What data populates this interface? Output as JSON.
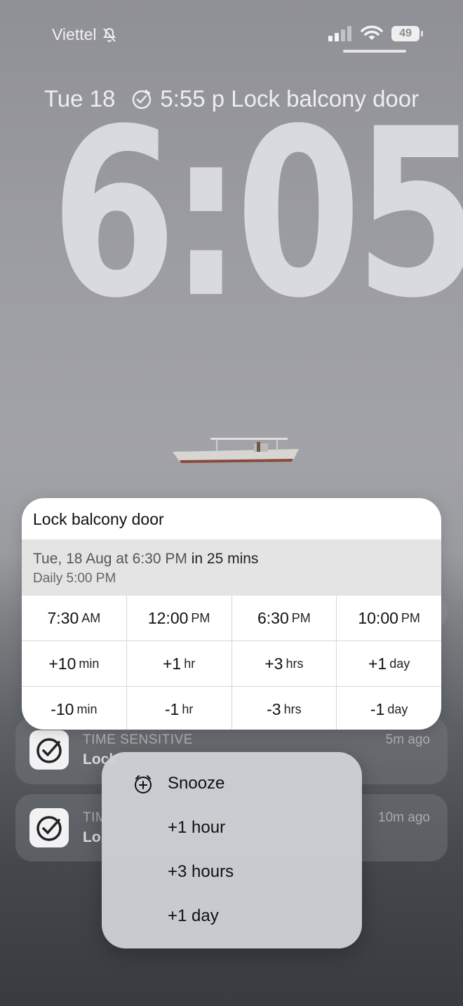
{
  "status_bar": {
    "carrier": "Viettel",
    "battery": "49",
    "icons": [
      "bell-slash-icon",
      "cellular-signal-icon",
      "wifi-icon",
      "battery-icon"
    ]
  },
  "lock_screen": {
    "date": "Tue 18",
    "widget_text": "5:55 p Lock balcony door",
    "time": "6:05"
  },
  "card": {
    "title": "Lock balcony door",
    "due_date": "Tue, 18 Aug at 6:30 PM",
    "due_relative": "in 25 mins",
    "repeat": "Daily 5:00 PM",
    "rows": [
      [
        {
          "v": "7:30",
          "u": "AM"
        },
        {
          "v": "12:00",
          "u": "PM"
        },
        {
          "v": "6:30",
          "u": "PM"
        },
        {
          "v": "10:00",
          "u": "PM"
        }
      ],
      [
        {
          "v": "+10",
          "u": "min"
        },
        {
          "v": "+1",
          "u": "hr"
        },
        {
          "v": "+3",
          "u": "hrs"
        },
        {
          "v": "+1",
          "u": "day"
        }
      ],
      [
        {
          "v": "-10",
          "u": "min"
        },
        {
          "v": "-1",
          "u": "hr"
        },
        {
          "v": "-3",
          "u": "hrs"
        },
        {
          "v": "-1",
          "u": "day"
        }
      ]
    ]
  },
  "notifications": [
    {
      "app": "TIME SENSITIVE",
      "title": "Lock",
      "time": "5m ago"
    },
    {
      "app": "TIM",
      "title": "Lo",
      "time": "10m ago"
    }
  ],
  "menu": {
    "items": [
      "Snooze",
      "+1 hour",
      "+3 hours",
      "+1 day"
    ]
  }
}
